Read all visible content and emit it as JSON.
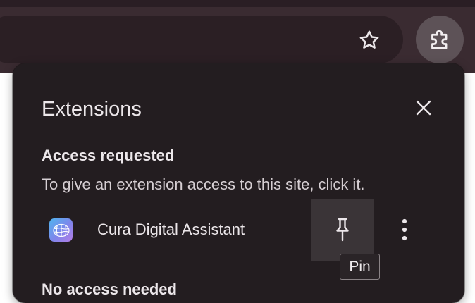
{
  "browser": {
    "bookmark_icon": "star-outline-icon",
    "extensions_icon": "puzzle-icon"
  },
  "popup": {
    "title": "Extensions",
    "close_icon": "close-icon",
    "section": {
      "heading": "Access requested",
      "description": "To give an extension access to this site, click it."
    },
    "extension": {
      "name": "Cura Digital Assistant",
      "icon": "brain-icon",
      "pin_icon": "pin-icon",
      "more_icon": "vertical-dots-icon"
    },
    "tooltip": "Pin",
    "next_section_heading": "No access needed"
  },
  "colors": {
    "popup_bg": "#231d20",
    "toolbar_bg": "#3a2b31",
    "text_primary": "#ece7ea",
    "pin_button_bg": "#3a3437"
  }
}
